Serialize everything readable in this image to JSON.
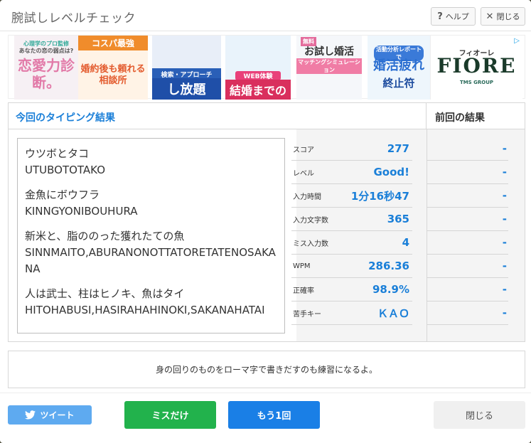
{
  "window": {
    "title": "腕試しレベルチェック",
    "help_label": "ヘルプ",
    "close_label": "閉じる"
  },
  "ads": [
    {
      "lines": [
        "心理学のプロ監修",
        "あなたの恋の弱点は?",
        "恋愛力診断。"
      ]
    },
    {
      "lines": [
        "コスパ最強",
        "婚約後も頼れる相談所"
      ]
    },
    {
      "lines": [
        "検索・アプローチ",
        "し放題"
      ]
    },
    {
      "lines": [
        "WEB体験",
        "結婚までの流れ"
      ]
    },
    {
      "lines": [
        "無料",
        "お試し婚活",
        "マッチングシミュレーション"
      ]
    },
    {
      "lines": [
        "活動分析レポートで",
        "婚活疲れ",
        "終止符"
      ]
    },
    {
      "lines": [
        "フィオーレ",
        "FIORE",
        "TMS GROUP"
      ]
    }
  ],
  "results": {
    "title": "今回のタイピング結果",
    "prev_title": "前回の結果",
    "typed_pairs": [
      {
        "jp": "ウツボとタコ",
        "romaji": "UTUBOTOTAKO"
      },
      {
        "jp": "金魚にボウフラ",
        "romaji": "KINNGYONIBOUHURA"
      },
      {
        "jp": "新米と、脂ののった獲れたての魚",
        "romaji": "SINNMAITO,ABURANONOTTATORETATENOSAKANA"
      },
      {
        "jp": "人は武士、柱はヒノキ、魚はタイ",
        "romaji": "HITOHABUSI,HASIRAHAHINOKI,SAKANAHATAI"
      }
    ],
    "stats": [
      {
        "label": "スコア",
        "value": "277",
        "prev": "-"
      },
      {
        "label": "レベル",
        "value": "Good!",
        "prev": "-"
      },
      {
        "label": "入力時間",
        "value": "1分16秒47",
        "prev": "-"
      },
      {
        "label": "入力文字数",
        "value": "365",
        "prev": "-"
      },
      {
        "label": "ミス入力数",
        "value": "4",
        "prev": "-"
      },
      {
        "label": "WPM",
        "value": "286.36",
        "prev": "-"
      },
      {
        "label": "正確率",
        "value": "98.9%",
        "prev": "-"
      },
      {
        "label": "苦手キー",
        "value": "ＫＡＯ",
        "prev": "-"
      }
    ]
  },
  "message": "身の回りのものをローマ字で書きだすのも練習になるよ。",
  "buttons": {
    "tweet": "ツイート",
    "miss_only": "ミスだけ",
    "retry": "もう1回",
    "close": "閉じる"
  }
}
